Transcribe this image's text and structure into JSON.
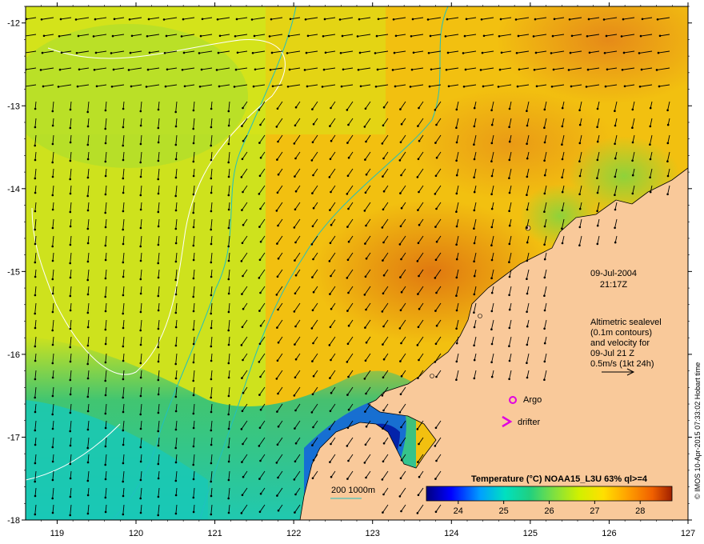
{
  "map": {
    "lon_range": [
      118.6,
      127
    ],
    "lat_range": [
      -18,
      -11.8
    ],
    "x_ticks": [
      "119",
      "120",
      "121",
      "122",
      "123",
      "124",
      "125",
      "126",
      "127"
    ],
    "y_ticks": [
      "-12",
      "-13",
      "-14",
      "-15",
      "-16",
      "-17",
      "-18"
    ],
    "land_color": "#F9C99A",
    "date": "09-Jul-2004",
    "time": "21:17Z",
    "info_lines": [
      "Altimetric sealevel",
      "(0.1m contours)",
      "and velocity for",
      "09-Jul 21 Z",
      "0.5m/s (1kt 24h)"
    ],
    "argo_label": "Argo",
    "drifter_label": "drifter",
    "depth_label": "200  1000m",
    "credit": "© IMOS 10-Apr-2015 07:33:02 Hobart time"
  },
  "colorbar": {
    "title": "Temperature (°C) NOAA15_L3U 63% ql>=4",
    "ticks": [
      "24",
      "25",
      "26",
      "27",
      "28"
    ],
    "range": [
      23.3,
      28.7
    ],
    "colors": [
      "#00007F",
      "#0000FF",
      "#00A0FF",
      "#00E0C0",
      "#20D080",
      "#7FE040",
      "#D0F000",
      "#FFE000",
      "#FFA000",
      "#F06000",
      "#A02000"
    ]
  },
  "icons": {
    "argo": "circle-marker-icon",
    "drifter": "chevron-marker-icon",
    "velocity": "arrow-icon"
  }
}
